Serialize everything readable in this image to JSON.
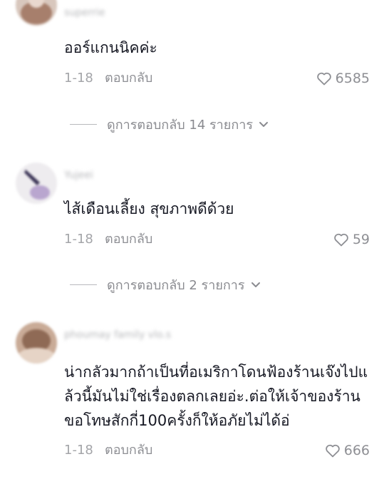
{
  "comments": [
    {
      "username": "superrie",
      "text": "ออร์แกนนิคค่ะ",
      "date": "1-18",
      "reply_label": "ตอบกลับ",
      "likes": "6585",
      "view_replies": "ดูการตอบกลับ 14 รายการ"
    },
    {
      "username": "Yujeei",
      "text": "ไส้เดือนเลี้ยง สุขภาพดีด้วย",
      "date": "1-18",
      "reply_label": "ตอบกลับ",
      "likes": "59",
      "view_replies": "ดูการตอบกลับ 2 รายการ"
    },
    {
      "username": "phoumay family vlo.s",
      "text": "น่ากลัวมากถ้าเป็นที่อเมริกาโดนฟ้องร้านเจ๊งไปแล้วนี้มันไม่ใช่เรื่องตลกเลยอ่ะ.ต่อให้เจ้าของร้านขอโทษสักกี่100ครั้งก็ให้อภัยไม่ได้อ่",
      "date": "1-18",
      "reply_label": "ตอบกลับ",
      "likes": "666"
    }
  ],
  "colors": {
    "text": "#161823",
    "secondary": "#8e8f94",
    "divider": "#b8b9bd"
  },
  "icons": {
    "like": "heart-outline-icon",
    "expand": "chevron-down-icon"
  }
}
